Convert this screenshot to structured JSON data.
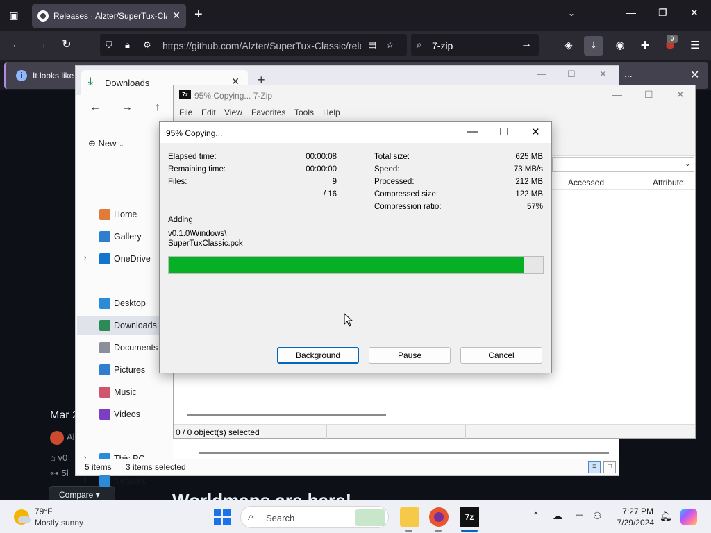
{
  "firefox": {
    "tab_title": "Releases · Alzter/SuperTux-Cla",
    "url": "https://github.com/Alzter/SuperTux-Classic/rele",
    "search_value": "7-zip",
    "ublock_count": "9",
    "notice_text": "It looks like",
    "notice_more": "..."
  },
  "github": {
    "date": "Mar 2",
    "author": "Al",
    "tag": "v0",
    "commit": "5l",
    "compare_label": "Compare",
    "heading": "Worldmaps are here!"
  },
  "explorer": {
    "tab_title": "Downloads",
    "new_label": "New",
    "sidebar": [
      {
        "label": "Home",
        "icon": "home-icon",
        "color": "#e27a3a",
        "chevron": false
      },
      {
        "label": "Gallery",
        "icon": "gallery-icon",
        "color": "#2f7fd1",
        "chevron": false
      },
      {
        "label": "OneDrive",
        "icon": "onedrive-icon",
        "color": "#1474cc",
        "chevron": true
      },
      {
        "label": "Desktop",
        "icon": "desktop-icon",
        "color": "#2a8bd6",
        "chevron": false
      },
      {
        "label": "Downloads",
        "icon": "downloads-icon",
        "color": "#2b8a55",
        "chevron": false,
        "selected": true
      },
      {
        "label": "Documents",
        "icon": "documents-icon",
        "color": "#8a8f9a",
        "chevron": false
      },
      {
        "label": "Pictures",
        "icon": "pictures-icon",
        "color": "#2f7fd1",
        "chevron": false
      },
      {
        "label": "Music",
        "icon": "music-icon",
        "color": "#d0566b",
        "chevron": false
      },
      {
        "label": "Videos",
        "icon": "videos-icon",
        "color": "#7c3fc4",
        "chevron": false
      },
      {
        "label": "This PC",
        "icon": "this-pc-icon",
        "color": "#2a8bd6",
        "chevron": true
      },
      {
        "label": "Network",
        "icon": "network-icon",
        "color": "#2a8bd6",
        "chevron": true
      }
    ],
    "status_items": "5 items",
    "status_selected": "3 items selected"
  },
  "sevenzip_main": {
    "title": "95% Copying... 7-Zip",
    "menu": [
      "File",
      "Edit",
      "View",
      "Favorites",
      "Tools",
      "Help"
    ],
    "columns": [
      "Accessed",
      "Attribute"
    ],
    "status": "0 / 0 object(s) selected"
  },
  "dialog": {
    "title": "95% Copying...",
    "left_stats": [
      {
        "label": "Elapsed time:",
        "value": "00:00:08"
      },
      {
        "label": "Remaining time:",
        "value": "00:00:00"
      },
      {
        "label": "Files:",
        "value": "9"
      },
      {
        "label": "",
        "value": "/ 16"
      }
    ],
    "right_stats": [
      {
        "label": "Total size:",
        "value": "625 MB"
      },
      {
        "label": "Speed:",
        "value": "73 MB/s"
      },
      {
        "label": "Processed:",
        "value": "212 MB"
      },
      {
        "label": "Compressed size:",
        "value": "122 MB"
      },
      {
        "label": "Compression ratio:",
        "value": "57%"
      }
    ],
    "action": "Adding",
    "file_line1": "v0.1.0\\Windows\\",
    "file_line2": "SuperTuxClassic.pck",
    "progress_percent": 95,
    "buttons": {
      "background": "Background",
      "pause": "Pause",
      "cancel": "Cancel"
    }
  },
  "taskbar": {
    "temp": "79°F",
    "condition": "Mostly sunny",
    "search_label": "Search",
    "sevenzip_label": "7z",
    "time": "7:27 PM",
    "date": "7/29/2024"
  },
  "colors": {
    "progress": "#06b025",
    "accent": "#0067c0"
  }
}
